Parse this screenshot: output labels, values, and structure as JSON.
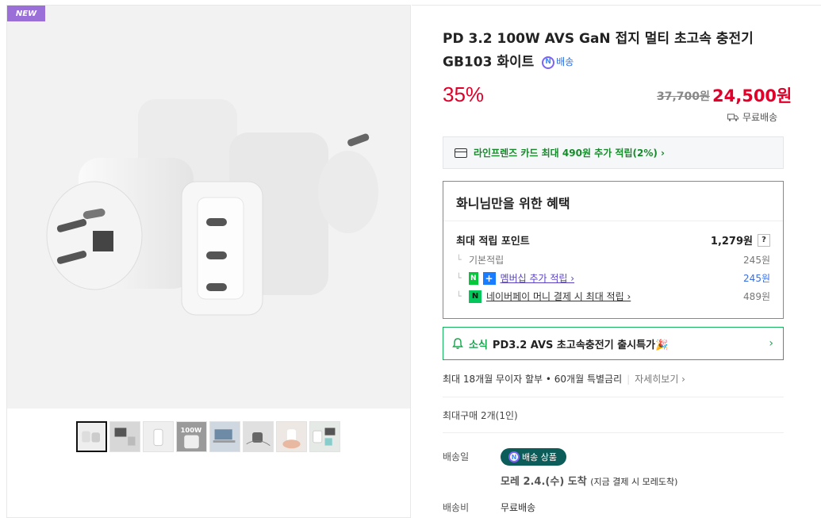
{
  "gallery": {
    "badge": "NEW",
    "main_image_alt": "",
    "thumbnails": [
      {
        "name": "thumb-charger-white",
        "active": true
      },
      {
        "name": "thumb-desk-setup",
        "active": false
      },
      {
        "name": "thumb-plugged-wall",
        "active": false
      },
      {
        "name": "thumb-100w-banner",
        "active": false,
        "text": "100W"
      },
      {
        "name": "thumb-laptop",
        "active": false
      },
      {
        "name": "thumb-cables",
        "active": false
      },
      {
        "name": "thumb-hand",
        "active": false
      },
      {
        "name": "thumb-devices",
        "active": false
      }
    ]
  },
  "product": {
    "title": "PD 3.2 100W AVS GaN 접지 멀티 초고속 충전기 GB103 화이트",
    "npay_delivery": "배송",
    "discount": "35%",
    "original_price": "37,700원",
    "sale_price": "24,500원",
    "shipping_top": "무료배송",
    "card_offer": "라인프렌즈 카드 최대 490원 추가 적립(2%) ›"
  },
  "benefit": {
    "title": "화니님만을 위한 혜택",
    "max_points_label": "최대 적립 포인트",
    "max_points_value": "1,279원",
    "help": "?",
    "rows": [
      {
        "label": "기본적립",
        "value": "245원"
      },
      {
        "label": "멤버십 추가 적립 ›",
        "value": "245원"
      },
      {
        "label": "네이버페이 머니 결제 시 최대 적립 ›",
        "value": "489원"
      }
    ],
    "tag_n": "N",
    "tag_plus": "+",
    "tag_pay": "N"
  },
  "news": {
    "label": "소식",
    "text": "PD3.2 AVS 초고속충전기 출시특가🎉",
    "arrow": "›"
  },
  "installment": {
    "text": "최대 18개월 무이자 할부 • 60개월 특별금리",
    "detail": "자세히보기 ›"
  },
  "max_purchase": "최대구매 2개(1인)",
  "delivery": {
    "label": "배송일",
    "badge": "배송 상품",
    "date": "모레 2.4.(수) 도착",
    "note": "(지금 결제 시 모레도착)",
    "fee_label": "배송비",
    "fee_value": "무료배송"
  },
  "colors": {
    "accent_red": "#e0002a",
    "naver_green": "#03c75a",
    "badge_purple": "#9a6fd8",
    "delivery_badge": "#0c5c5a"
  }
}
